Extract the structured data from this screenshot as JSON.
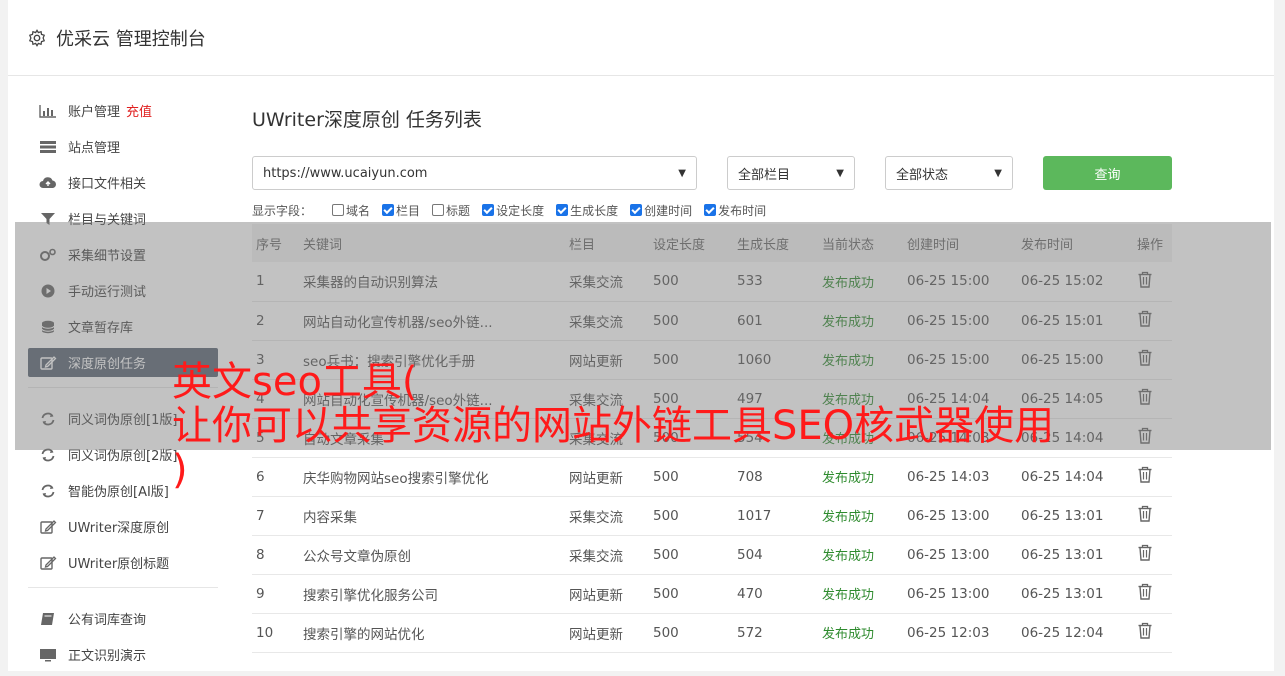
{
  "header": {
    "title": "优采云 管理控制台",
    "icon": "gear-icon"
  },
  "sidebar": {
    "groups": [
      [
        {
          "label": "账户管理",
          "badge": "充值",
          "icon": "bar-chart-icon"
        },
        {
          "label": "站点管理",
          "icon": "server-icon"
        },
        {
          "label": "接口文件相关",
          "icon": "cloud-upload-icon"
        },
        {
          "label": "栏目与关键词",
          "icon": "filter-icon"
        },
        {
          "label": "采集细节设置",
          "icon": "cogs-icon"
        },
        {
          "label": "手动运行测试",
          "icon": "play-circle-icon"
        },
        {
          "label": "文章暂存库",
          "icon": "database-icon"
        },
        {
          "label": "深度原创任务",
          "icon": "edit-icon",
          "active": true
        }
      ],
      [
        {
          "label": "同义词伪原创[1版]",
          "icon": "refresh-icon"
        },
        {
          "label": "同义词伪原创[2版]",
          "icon": "refresh-icon"
        },
        {
          "label": "智能伪原创[AI版]",
          "icon": "refresh-icon"
        },
        {
          "label": "UWriter深度原创",
          "icon": "edit-icon"
        },
        {
          "label": "UWriter原创标题",
          "icon": "edit-icon"
        }
      ],
      [
        {
          "label": "公有词库查询",
          "icon": "book-icon"
        },
        {
          "label": "正文识别演示",
          "icon": "monitor-icon"
        }
      ]
    ]
  },
  "main": {
    "title": "UWriter深度原创 任务列表",
    "site_select": "https://www.ucaiyun.com",
    "column_select": "全部栏目",
    "status_select": "全部状态",
    "query_label": "查询",
    "fields_label": "显示字段：",
    "fields": [
      {
        "label": "域名",
        "checked": false
      },
      {
        "label": "栏目",
        "checked": true
      },
      {
        "label": "标题",
        "checked": false
      },
      {
        "label": "设定长度",
        "checked": true
      },
      {
        "label": "生成长度",
        "checked": true
      },
      {
        "label": "创建时间",
        "checked": true
      },
      {
        "label": "发布时间",
        "checked": true
      }
    ],
    "table": {
      "headers": [
        "序号",
        "关键词",
        "栏目",
        "设定长度",
        "生成长度",
        "当前状态",
        "创建时间",
        "发布时间",
        "操作"
      ],
      "rows": [
        [
          "1",
          "采集器的自动识别算法",
          "采集交流",
          "500",
          "533",
          "发布成功",
          "06-25 15:00",
          "06-25 15:02"
        ],
        [
          "2",
          "网站自动化宣传机器/seo外链...",
          "采集交流",
          "500",
          "601",
          "发布成功",
          "06-25 15:00",
          "06-25 15:01"
        ],
        [
          "3",
          "seo兵书：搜索引擎优化手册",
          "网站更新",
          "500",
          "1060",
          "发布成功",
          "06-25 15:00",
          "06-25 15:00"
        ],
        [
          "4",
          "网站自动化宣传机器/seo外链...",
          "采集交流",
          "500",
          "497",
          "发布成功",
          "06-25 14:04",
          "06-25 14:05"
        ],
        [
          "5",
          "自动文章采集",
          "采集交流",
          "500",
          "554",
          "发布成功",
          "06-25 14:03",
          "06-25 14:04"
        ],
        [
          "6",
          "庆华购物网站seo搜索引擎优化",
          "网站更新",
          "500",
          "708",
          "发布成功",
          "06-25 14:03",
          "06-25 14:04"
        ],
        [
          "7",
          "内容采集",
          "采集交流",
          "500",
          "1017",
          "发布成功",
          "06-25 13:00",
          "06-25 13:01"
        ],
        [
          "8",
          "公众号文章伪原创",
          "采集交流",
          "500",
          "504",
          "发布成功",
          "06-25 13:00",
          "06-25 13:01"
        ],
        [
          "9",
          "搜索引擎优化服务公司",
          "网站更新",
          "500",
          "470",
          "发布成功",
          "06-25 13:00",
          "06-25 13:01"
        ],
        [
          "10",
          "搜索引擎的网站优化",
          "网站更新",
          "500",
          "572",
          "发布成功",
          "06-25 12:03",
          "06-25 12:04"
        ]
      ]
    }
  },
  "overlay": {
    "line1": "英文seo工具(",
    "line2": "让你可以共享资源的网站外链工具SEO核武器使用",
    "line3": ")"
  },
  "colors": {
    "status_success": "#2e8b2e",
    "query_button": "#5cb85c",
    "active_nav": "#5b6776",
    "badge": "#e02020",
    "overlay_text": "#ff1a1a"
  }
}
